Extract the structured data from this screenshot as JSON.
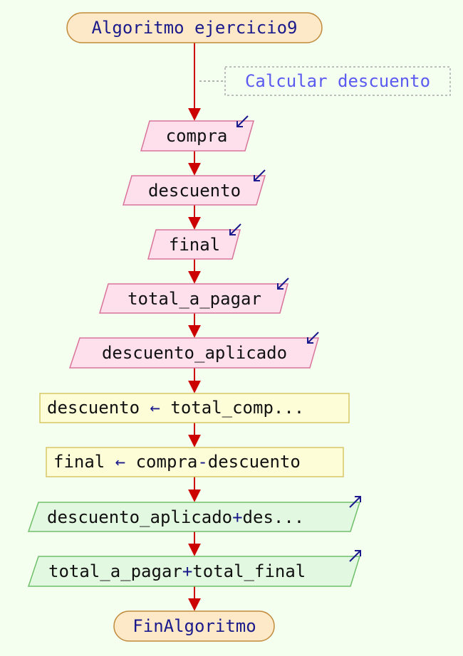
{
  "start": {
    "label": "Algoritmo ejercicio9"
  },
  "comment": {
    "text": "Calcular descuento"
  },
  "inputs": [
    {
      "label": "compra"
    },
    {
      "label": "descuento"
    },
    {
      "label": "final"
    },
    {
      "label": "total_a_pagar"
    },
    {
      "label": "descuento_aplicado"
    }
  ],
  "assignments": [
    {
      "target": "descuento",
      "op": "←",
      "expr": "total_comp..."
    },
    {
      "target": "final",
      "op": "←",
      "expr_a": "compra",
      "minus": "-",
      "expr_b": "descuento"
    }
  ],
  "outputs": [
    {
      "a": "descuento_aplicado",
      "plus": "+",
      "b": "des..."
    },
    {
      "a": "total_a_pagar",
      "plus": "+",
      "b": "total_final"
    }
  ],
  "end": {
    "label": "FinAlgoritmo"
  },
  "colors": {
    "arrow": "#cc0000",
    "terminal_fill": "#fde9c8",
    "terminal_stroke": "#c08a3a",
    "input_fill": "#fde0ec",
    "input_stroke": "#d9739a",
    "process_fill": "#fdfdd8",
    "process_stroke": "#d6c766",
    "output_fill": "#e3f8e0",
    "output_stroke": "#6fbf6a",
    "keyword": "#1a1a8c",
    "comment": "#5a5af0",
    "io_icon": "#1a1a8c"
  }
}
